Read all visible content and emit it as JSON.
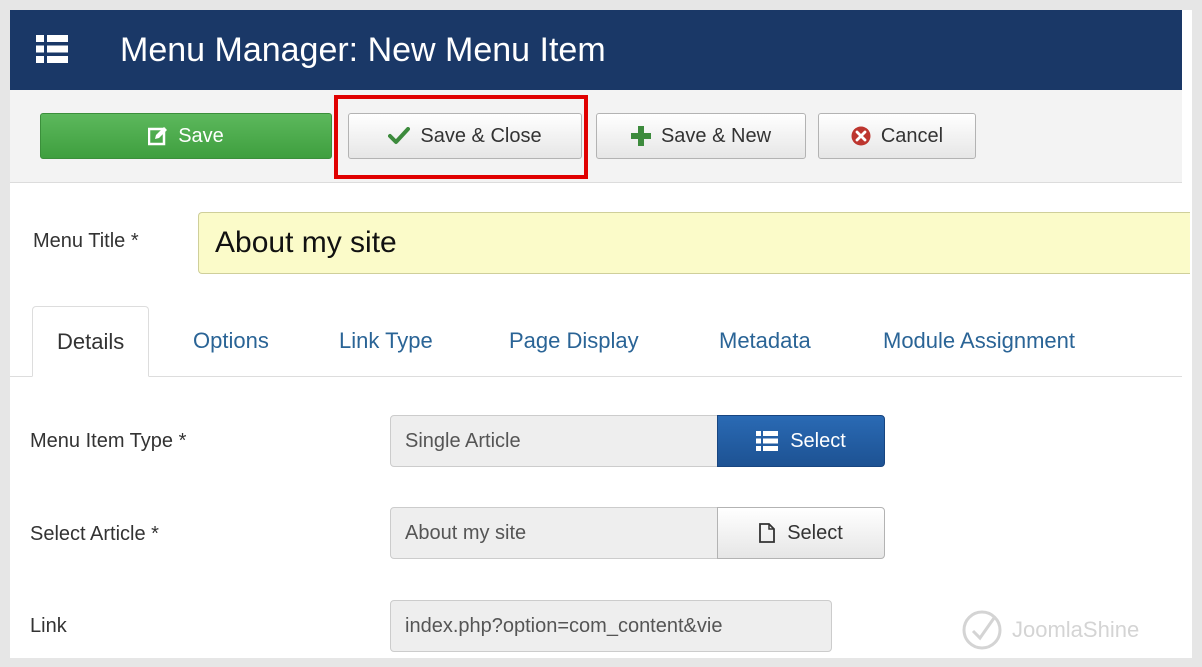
{
  "header": {
    "title": "Menu Manager: New Menu Item",
    "background": "#1a3867",
    "icon": "list-icon"
  },
  "toolbar": {
    "buttons": [
      {
        "label": "Save",
        "icon": "edit-icon",
        "style": "success"
      },
      {
        "label": "Save & Close",
        "icon": "check-icon",
        "highlighted": true
      },
      {
        "label": "Save & New",
        "icon": "plus-icon"
      },
      {
        "label": "Cancel",
        "icon": "cancel-icon"
      }
    ]
  },
  "title_field": {
    "label": "Menu Title *",
    "value": "About my site"
  },
  "tabs": [
    {
      "label": "Details",
      "active": true
    },
    {
      "label": "Options"
    },
    {
      "label": "Link Type"
    },
    {
      "label": "Page Display"
    },
    {
      "label": "Metadata"
    },
    {
      "label": "Module Assignment"
    }
  ],
  "form": {
    "menu_item_type": {
      "label": "Menu Item Type *",
      "value": "Single Article",
      "button": "Select"
    },
    "select_article": {
      "label": "Select Article *",
      "value": "About my site",
      "button": "Select"
    },
    "link": {
      "label": "Link",
      "value": "index.php?option=com_content&vie"
    }
  },
  "watermark": "JoomlaShine",
  "colors": {
    "highlight": "#e00000",
    "save_green": "#4cae4c",
    "select_blue": "#2a6ab4",
    "title_input_bg": "#fbfbc9"
  }
}
